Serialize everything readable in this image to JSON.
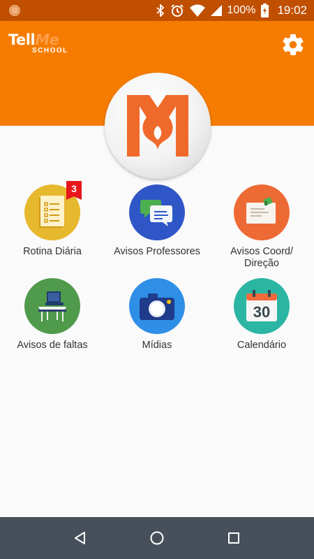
{
  "status_bar": {
    "battery_text": "100%",
    "time": "19:02",
    "icons": [
      "app-notification-icon",
      "bluetooth-icon",
      "alarm-icon",
      "wifi-icon",
      "cell-signal-icon",
      "battery-charging-icon"
    ]
  },
  "header": {
    "logo": {
      "part1": "Tell",
      "part2": "Me",
      "sub": "SCHOOL"
    },
    "settings_icon": "gear-icon",
    "background_color": "#f57c00"
  },
  "menu": {
    "items": [
      {
        "label": "Rotina Diária",
        "icon": "checklist-notebook-icon",
        "color": "#e6b82d",
        "badge": "3"
      },
      {
        "label": "Avisos Professores",
        "icon": "chat-bubbles-icon",
        "color": "#2f56c6"
      },
      {
        "label": "Avisos Coord/ Direção",
        "icon": "note-envelope-icon",
        "color": "#ee6a35"
      },
      {
        "label": "Avisos de faltas",
        "icon": "school-desk-icon",
        "color": "#4f9a4b"
      },
      {
        "label": "Mídias",
        "icon": "camera-icon",
        "color": "#2f8fe6"
      },
      {
        "label": "Calendário",
        "icon": "calendar-icon",
        "color": "#2bb5a3",
        "calendar_day": "30"
      }
    ]
  },
  "nav_bar": {
    "icons": [
      "back-icon",
      "home-icon",
      "recents-icon"
    ]
  }
}
